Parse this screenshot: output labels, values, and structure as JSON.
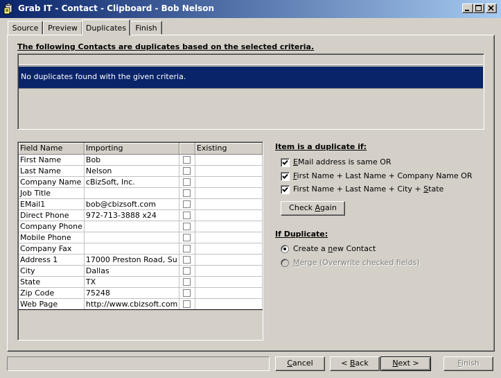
{
  "window": {
    "title": "Grab IT - Contact - Clipboard - Bob Nelson",
    "minimize_glyph": "_",
    "maximize_glyph": "□",
    "close_glyph": "×"
  },
  "tabs": [
    {
      "label": "Source",
      "active": false
    },
    {
      "label": "Preview",
      "active": false
    },
    {
      "label": "Duplicates",
      "active": true
    },
    {
      "label": "Finish",
      "active": false
    }
  ],
  "duplicates": {
    "heading": "The following Contacts are duplicates based on the selected criteria.",
    "message": "No duplicates found with the given criteria."
  },
  "grid": {
    "columns": [
      "Field Name",
      "Importing",
      "",
      "Existing"
    ],
    "rows": [
      {
        "field": "First Name",
        "importing": "Bob",
        "existing": ""
      },
      {
        "field": "Last Name",
        "importing": "Nelson",
        "existing": ""
      },
      {
        "field": "Company Name",
        "importing": "cBizSoft, Inc.",
        "existing": ""
      },
      {
        "field": "Job Title",
        "importing": "",
        "existing": ""
      },
      {
        "field": "EMail1",
        "importing": "bob@cbizsoft.com",
        "existing": ""
      },
      {
        "field": "Direct Phone",
        "importing": "972-713-3888 x24",
        "existing": ""
      },
      {
        "field": "Company Phone",
        "importing": "",
        "existing": ""
      },
      {
        "field": "Mobile Phone",
        "importing": "",
        "existing": ""
      },
      {
        "field": "Company Fax",
        "importing": "",
        "existing": ""
      },
      {
        "field": "Address 1",
        "importing": "17000 Preston Road, Su",
        "existing": ""
      },
      {
        "field": "City",
        "importing": "Dallas",
        "existing": ""
      },
      {
        "field": "State",
        "importing": "TX",
        "existing": ""
      },
      {
        "field": "Zip Code",
        "importing": "75248",
        "existing": ""
      },
      {
        "field": "Web Page",
        "importing": "http://www.cbizsoft.com",
        "existing": ""
      }
    ]
  },
  "criteria": {
    "heading": "Item is a duplicate if:",
    "options": [
      {
        "prefix": "",
        "accel": "E",
        "rest": "Mail address is same OR",
        "checked": true
      },
      {
        "prefix": "",
        "accel": "F",
        "rest": "irst Name + Last Name + Company Name OR",
        "checked": true
      },
      {
        "prefix": "First Name + Last Name + City + ",
        "accel": "S",
        "rest": "tate",
        "checked": true
      }
    ],
    "check_again": {
      "prefix": "Check ",
      "accel": "A",
      "rest": "gain"
    }
  },
  "if_duplicate": {
    "heading": "If Duplicate:",
    "options": [
      {
        "prefix": "Create a ",
        "accel": "n",
        "rest": "ew Contact",
        "selected": true,
        "enabled": true
      },
      {
        "prefix": "",
        "accel": "M",
        "rest": "erge (Overwrite checked fields)",
        "selected": false,
        "enabled": false
      }
    ]
  },
  "buttons": {
    "cancel": {
      "prefix": "",
      "accel": "C",
      "rest": "ancel"
    },
    "back": {
      "prefix": "< ",
      "accel": "B",
      "rest": "ack"
    },
    "next": {
      "prefix": "",
      "accel": "N",
      "rest": "ext >"
    },
    "finish": {
      "prefix": "",
      "accel": "F",
      "rest": "inish"
    }
  },
  "status_text": ""
}
